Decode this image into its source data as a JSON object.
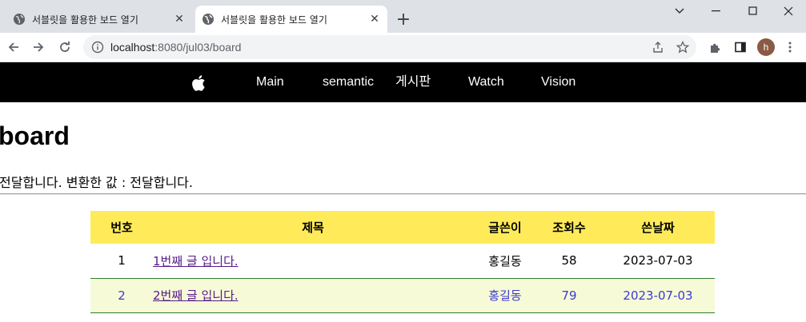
{
  "browser": {
    "tabs": [
      {
        "title": "서블릿을 활용한 보드 열기",
        "active": false
      },
      {
        "title": "서블릿을 활용한 보드 열기",
        "active": true
      }
    ],
    "url_host": "localhost",
    "url_path": ":8080/jul03/board",
    "profile_initial": "h"
  },
  "nav": {
    "items": [
      "Main",
      "semantic",
      "게시판",
      "Watch",
      "Vision"
    ]
  },
  "page": {
    "title": "board",
    "message": "전달합니다. 변환한 값 : 전달합니다."
  },
  "table": {
    "headers": [
      "번호",
      "제목",
      "글쓴이",
      "조회수",
      "쓴날짜"
    ],
    "rows": [
      {
        "no": "1",
        "title": "1번째 글 입니다.",
        "writer": "홍길동",
        "views": "58",
        "date": "2023-07-03"
      },
      {
        "no": "2",
        "title": "2번째 글 입니다.",
        "writer": "홍길동",
        "views": "79",
        "date": "2023-07-03"
      }
    ]
  },
  "colors": {
    "header_bg": "#ffeb5a",
    "even_row_bg": "#f7fad7",
    "row_border": "#2e7d32"
  }
}
